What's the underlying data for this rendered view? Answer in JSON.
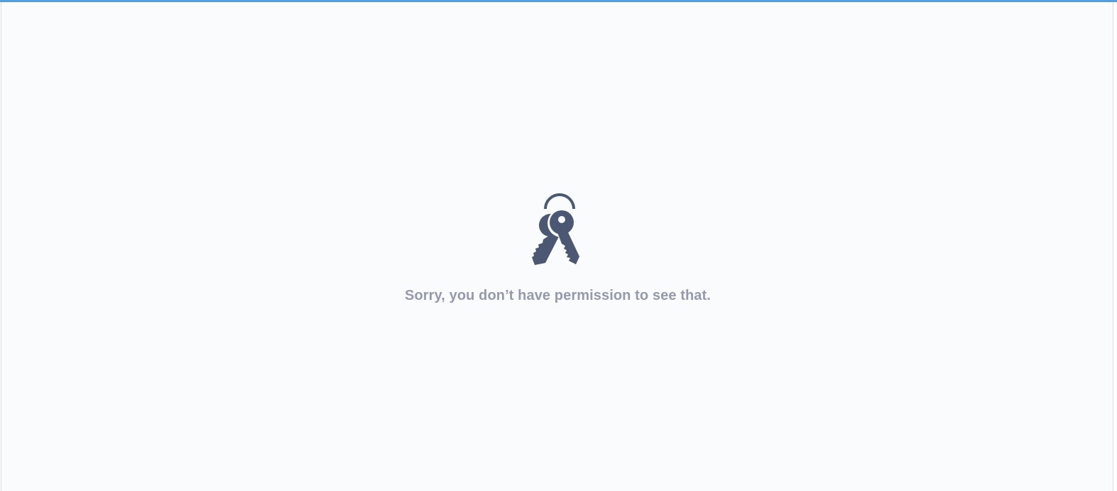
{
  "theme": {
    "accent_color": "#509ee3",
    "background_color": "#f9fbfc",
    "icon_color": "#4c5773",
    "text_color": "#949aab"
  },
  "empty_state": {
    "icon": "keys-icon",
    "message": "Sorry, you don’t have permission to see that."
  }
}
